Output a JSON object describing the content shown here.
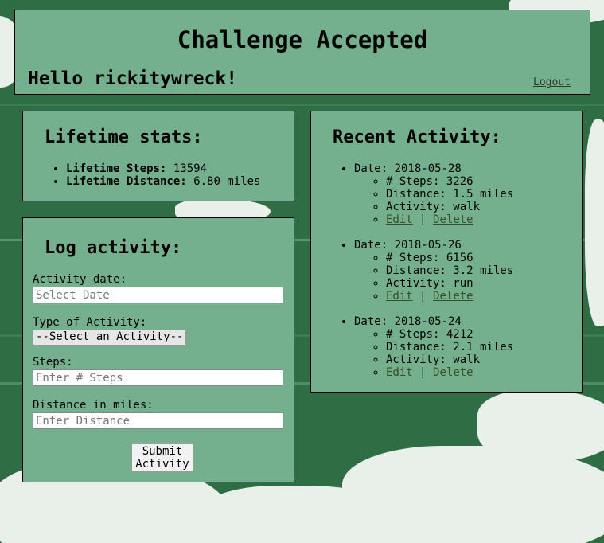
{
  "header": {
    "title": "Challenge Accepted",
    "greeting": "Hello rickitywreck!",
    "logout": "Logout"
  },
  "lifetime": {
    "heading": "Lifetime stats:",
    "steps_label": "Lifetime Steps:",
    "steps_value": "13594",
    "distance_label": "Lifetime Distance:",
    "distance_value": "6.80 miles"
  },
  "log": {
    "heading": "Log activity:",
    "date_label": "Activity date:",
    "date_placeholder": "Select Date",
    "type_label": "Type of Activity:",
    "type_selected": "--Select an Activity--",
    "steps_label": "Steps:",
    "steps_placeholder": "Enter # Steps",
    "distance_label": "Distance in miles:",
    "distance_placeholder": "Enter Distance",
    "submit_line1": "Submit",
    "submit_line2": "Activity"
  },
  "recent": {
    "heading": "Recent Activity:",
    "items": [
      {
        "date": "Date: 2018-05-28",
        "steps": "# Steps: 3226",
        "distance": "Distance: 1.5 miles",
        "activity": "Activity: walk",
        "edit": "Edit",
        "sep": "|",
        "delete": "Delete"
      },
      {
        "date": "Date: 2018-05-26",
        "steps": "# Steps: 6156",
        "distance": "Distance: 3.2 miles",
        "activity": "Activity: run",
        "edit": "Edit",
        "sep": "|",
        "delete": "Delete"
      },
      {
        "date": "Date: 2018-05-24",
        "steps": "# Steps: 4212",
        "distance": "Distance: 2.1 miles",
        "activity": "Activity: walk",
        "edit": "Edit",
        "sep": "|",
        "delete": "Delete"
      }
    ]
  },
  "colors": {
    "panel": "#74b08d",
    "background": "#2f6e44",
    "link": "#3b4a27"
  }
}
